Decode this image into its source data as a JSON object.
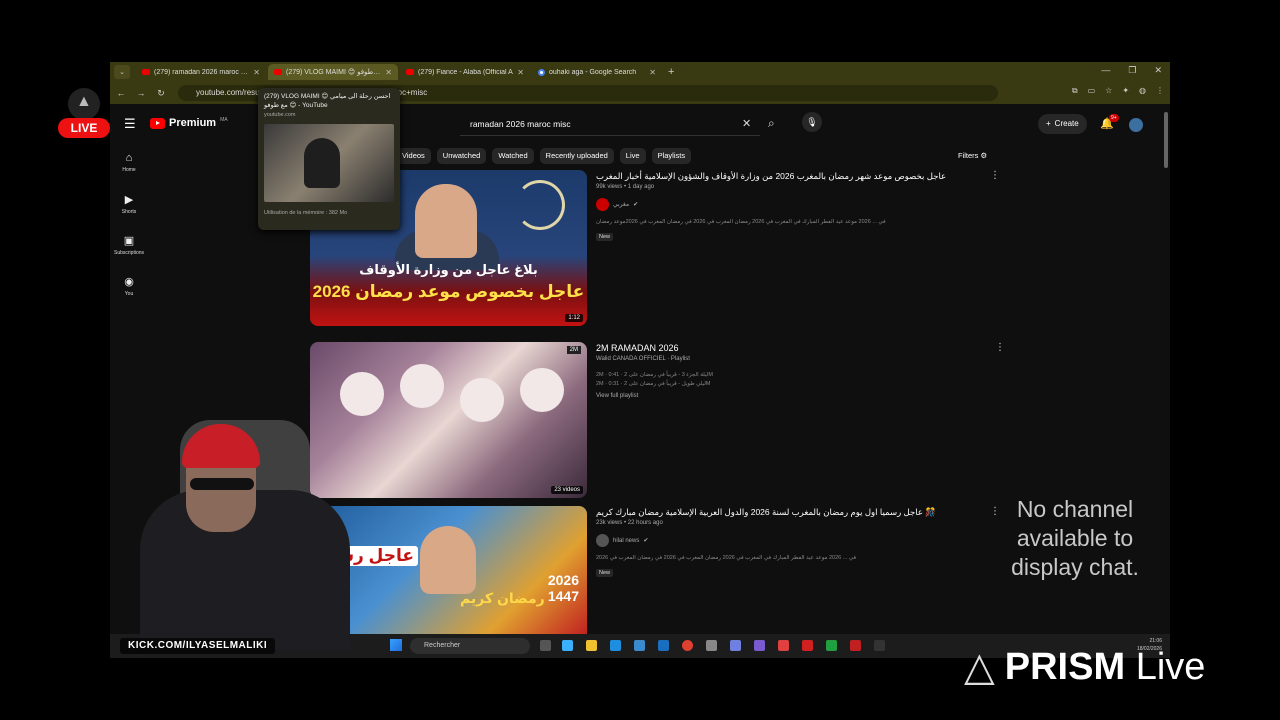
{
  "browser": {
    "tabs": [
      {
        "title": "(279) ramadan 2026 maroc misc",
        "active": false
      },
      {
        "title": "(279) VLOG MAIMI 😊 جو طوفو",
        "active": true
      },
      {
        "title": "(279) Fiance - Alaba (Official A",
        "active": false
      },
      {
        "title": "ouhaki aga - Google Search",
        "active": false
      }
    ],
    "address": "youtube.com/results?search_query=ramadan+2026+maroc+misc"
  },
  "hovercard": {
    "title": "(279) VLOG MAIMI 😊 احسن رحلة الى ميامي مع طوفو 😊 - YouTube",
    "url": "youtube.com",
    "memory": "Utilisation de la mémoire : 382 Mo"
  },
  "youtube": {
    "logo": "Premium",
    "country": "MA",
    "search_query": "ramadan 2026 maroc misc",
    "create_label": "Create",
    "notif_count": "9+",
    "nav": [
      {
        "label": "Home",
        "icon": "home-icon",
        "glyph": "⌂"
      },
      {
        "label": "Shorts",
        "icon": "shorts-icon",
        "glyph": "▶"
      },
      {
        "label": "Subscriptions",
        "icon": "subscriptions-icon",
        "glyph": "▣"
      },
      {
        "label": "You",
        "icon": "user-icon",
        "glyph": "◉"
      }
    ],
    "chips": [
      "Videos",
      "Unwatched",
      "Watched",
      "Recently uploaded",
      "Live",
      "Playlists"
    ],
    "filters_label": "Filters",
    "results": [
      {
        "title": "عاجل بخصوص موعد شهر رمضان بالمغرب 2026 من وزارة الأوقاف والشؤون الإسلامية أخبار المغرب",
        "sub": "99k views • 1 day ago",
        "channel": "مغربي",
        "desc": "في ... 2026 موعد عيد الفطر المبارك في المغرب في 2026 رمضان المغرب في 2026 في رمضان المغرب في 2026موعد رمضان",
        "badge": "New",
        "duration": "1:12",
        "thumb_line1": "بلاغ عاجل من وزارة الأوقاف",
        "thumb_line2": "عاجل بخصوص موعد رمضان 2026"
      },
      {
        "title": "2M RAMADAN 2026",
        "sub": "Walid CANADA OFFICIEL · Playlist",
        "line1": "2M · 0:41 · ليلة الجزء 3 - قريباً في رمضان على 2M",
        "line2": "2M · 0:31 · ليلي طويل - قريباً في رمضان على 2M",
        "link": "View full playlist",
        "videos": "23 videos"
      },
      {
        "title": "عاجل رسميا اول يوم رمضان بالمغرب لسنة 2026 والدول العربية الإسلامية رمضان مبارك كريم 🎊",
        "sub": "23k views • 22 hours ago",
        "channel": "hilal news",
        "desc": "في ... 2026 موعد عيد الفطر المبارك في المغرب في 2026 رمضان المغرب في 2026 في رمضان المغرب في 2026",
        "badge": "New",
        "thumb_txt": "عاجل رسم",
        "thumb_year": "2026",
        "thumb_hijri": "1447",
        "thumb_kareem": "رمضان كريم"
      }
    ]
  },
  "taskbar": {
    "search": "Rechercher",
    "time": "21:06",
    "date": "18/02/2026"
  },
  "overlay": {
    "live": "LIVE",
    "chat_msg": "No channel available to display chat.",
    "kick": "KICK.COM/ILYASELMALIKI",
    "prism_bold": "PRISM",
    "prism_light": "Live"
  },
  "colors": {
    "tabbar": "#3a3a12",
    "yt_bg": "#0f0f0f",
    "live_red": "#e11111",
    "yt_red": "#ff0000"
  }
}
